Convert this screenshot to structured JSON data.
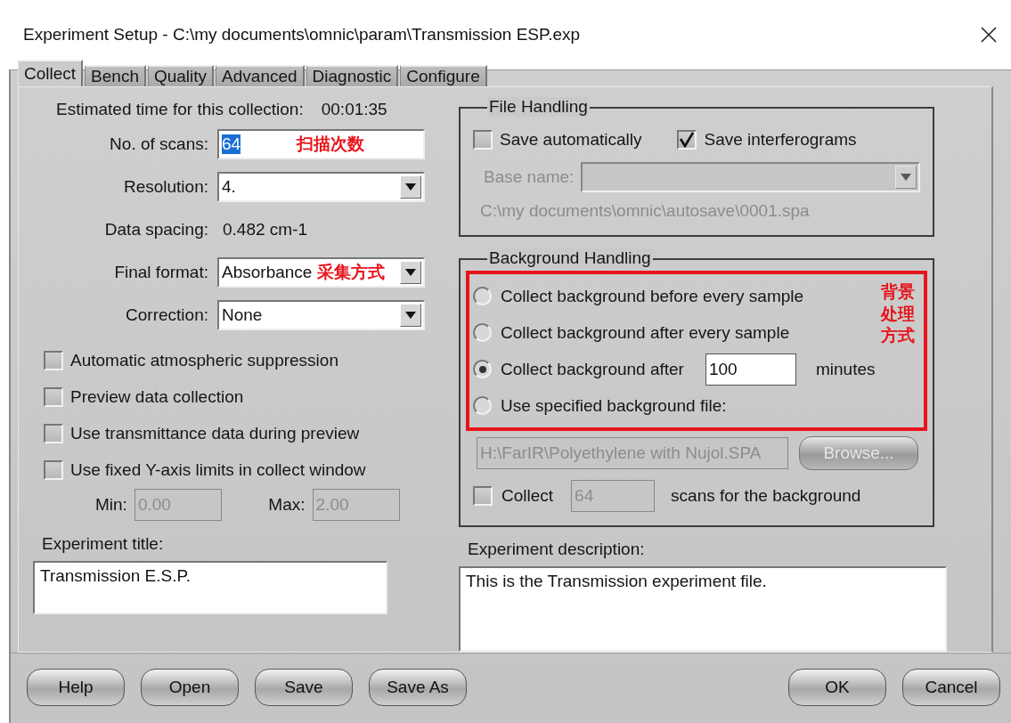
{
  "window": {
    "title": "Experiment Setup - C:\\my documents\\omnic\\param\\Transmission ESP.exp"
  },
  "tabs": [
    {
      "label": "Collect",
      "selected": true
    },
    {
      "label": "Bench",
      "selected": false
    },
    {
      "label": "Quality",
      "selected": false
    },
    {
      "label": "Advanced",
      "selected": false
    },
    {
      "label": "Diagnostic",
      "selected": false
    },
    {
      "label": "Configure",
      "selected": false
    }
  ],
  "estimated_time": {
    "label": "Estimated time for this collection:",
    "value": "00:01:35"
  },
  "form_rows": [
    {
      "kind": "input",
      "label": "No. of scans:",
      "value": "64",
      "highlighted": true,
      "note": "扫描次数"
    },
    {
      "kind": "dropdown",
      "label": "Resolution:",
      "value": "4."
    },
    {
      "kind": "text",
      "label": "Data spacing:",
      "value": "0.482 cm-1"
    },
    {
      "kind": "dropdown",
      "label": "Final format:",
      "value": "Absorbance",
      "note": "采集方式"
    },
    {
      "kind": "dropdown",
      "label": "Correction:",
      "value": "None"
    }
  ],
  "options": [
    {
      "label": "Automatic atmospheric suppression",
      "checked": false
    },
    {
      "label": "Preview data collection",
      "checked": false
    },
    {
      "label": "Use transmittance data during preview",
      "checked": false
    },
    {
      "label": "Use fixed Y-axis limits in collect window",
      "checked": false
    }
  ],
  "limits": [
    {
      "label": "Min:",
      "value": "0.00",
      "disabled": true
    },
    {
      "label": "Max:",
      "value": "2.00",
      "disabled": true
    }
  ],
  "experiment_title": {
    "label": "Experiment title:",
    "value": "Transmission E.S.P."
  },
  "file_handling": {
    "title": "File Handling",
    "checkboxes": [
      {
        "label": "Save automatically",
        "checked": false
      },
      {
        "label": "Save interferograms",
        "checked": true
      }
    ],
    "base_name": {
      "label": "Base name:",
      "disabled": true
    },
    "path": "C:\\my documents\\omnic\\autosave\\0001.spa"
  },
  "background_handling": {
    "title": "Background Handling",
    "note": "背景处理方式",
    "options": [
      {
        "kind": "plain",
        "label": "Collect background before every sample",
        "selected": false
      },
      {
        "kind": "plain",
        "label": "Collect background after every sample",
        "selected": false
      },
      {
        "kind": "minutes",
        "label": "Collect background after",
        "value": "100",
        "unit": "minutes",
        "selected": true
      },
      {
        "kind": "plain",
        "label": "Use specified background file:",
        "selected": false
      }
    ],
    "file": {
      "value": "H:\\FarIR\\Polyethylene with Nujol.SPA",
      "disabled": true
    },
    "browse_button": {
      "label": "Browse...",
      "disabled": true
    },
    "collect": {
      "label": "Collect",
      "checked": false,
      "value": "64",
      "value_disabled": true,
      "suffix": "scans for the background"
    }
  },
  "experiment_description": {
    "label": "Experiment description:",
    "value": "This is the Transmission experiment file."
  },
  "buttons_left": [
    "Help",
    "Open",
    "Save",
    "Save As"
  ],
  "buttons_right": [
    "OK",
    "Cancel"
  ]
}
